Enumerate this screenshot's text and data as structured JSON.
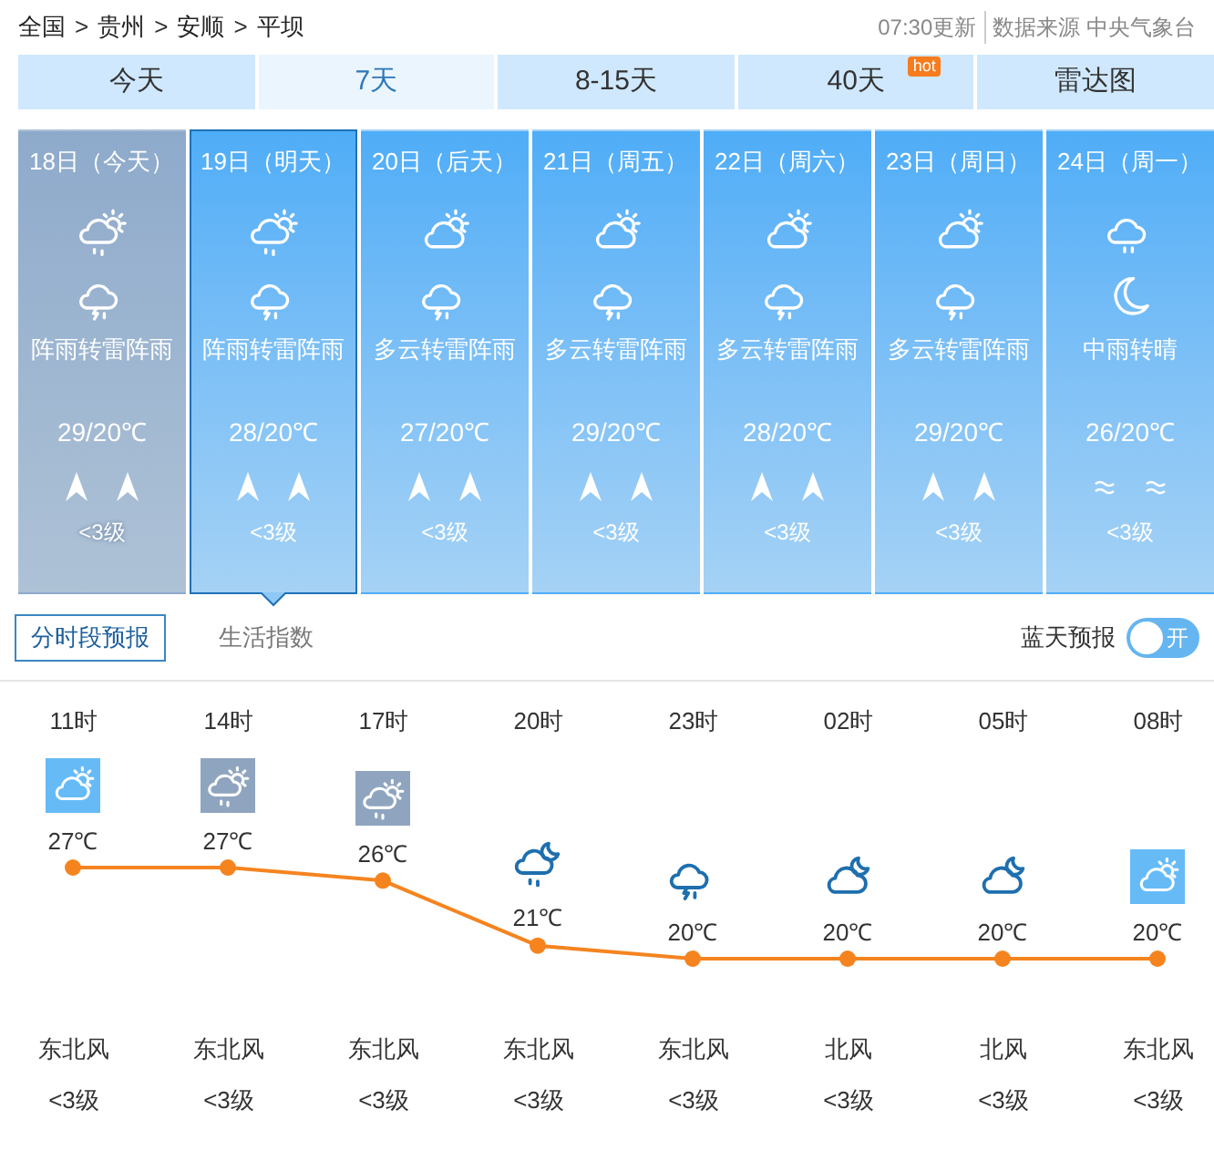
{
  "breadcrumb": [
    {
      "kind": "link",
      "text": "全国"
    },
    {
      "kind": "separator",
      "text": ">"
    },
    {
      "kind": "link",
      "text": "贵州"
    },
    {
      "kind": "separator",
      "text": ">"
    },
    {
      "kind": "link",
      "text": "安顺"
    },
    {
      "kind": "separator",
      "text": ">"
    },
    {
      "kind": "current",
      "text": "平坝"
    }
  ],
  "update_time": "07:30更新",
  "source": "数据来源 中央气象台",
  "tabs": [
    {
      "label": "今天",
      "selected": false
    },
    {
      "label": "7天",
      "selected": true
    },
    {
      "label": "8-15天",
      "selected": false
    },
    {
      "label": "40天",
      "selected": false,
      "badge": "hot"
    },
    {
      "label": "雷达图",
      "selected": false
    }
  ],
  "days": [
    {
      "date": "18日（今天）",
      "past": true,
      "selected": false,
      "icons": [
        {
          "kind": "shower"
        },
        {
          "kind": "thunder"
        }
      ],
      "weather": "阵雨转雷阵雨",
      "temp": "29/20℃",
      "wind_icons": [
        {
          "kind": "arrow"
        },
        {
          "kind": "arrow"
        }
      ],
      "wind_level": "<3级"
    },
    {
      "date": "19日（明天）",
      "past": false,
      "selected": true,
      "icons": [
        {
          "kind": "shower"
        },
        {
          "kind": "thunder"
        }
      ],
      "weather": "阵雨转雷阵雨",
      "temp": "28/20℃",
      "wind_icons": [
        {
          "kind": "arrow"
        },
        {
          "kind": "arrow"
        }
      ],
      "wind_level": "<3级"
    },
    {
      "date": "20日（后天）",
      "past": false,
      "selected": false,
      "icons": [
        {
          "kind": "cloudy"
        },
        {
          "kind": "thunder"
        }
      ],
      "weather": "多云转雷阵雨",
      "temp": "27/20℃",
      "wind_icons": [
        {
          "kind": "arrow"
        },
        {
          "kind": "arrow"
        }
      ],
      "wind_level": "<3级"
    },
    {
      "date": "21日（周五）",
      "past": false,
      "selected": false,
      "icons": [
        {
          "kind": "cloudy"
        },
        {
          "kind": "thunder"
        }
      ],
      "weather": "多云转雷阵雨",
      "temp": "29/20℃",
      "wind_icons": [
        {
          "kind": "arrow"
        },
        {
          "kind": "arrow"
        }
      ],
      "wind_level": "<3级"
    },
    {
      "date": "22日（周六）",
      "past": false,
      "selected": false,
      "icons": [
        {
          "kind": "cloudy"
        },
        {
          "kind": "thunder"
        }
      ],
      "weather": "多云转雷阵雨",
      "temp": "28/20℃",
      "wind_icons": [
        {
          "kind": "arrow"
        },
        {
          "kind": "arrow"
        }
      ],
      "wind_level": "<3级"
    },
    {
      "date": "23日（周日）",
      "past": false,
      "selected": false,
      "icons": [
        {
          "kind": "cloudy"
        },
        {
          "kind": "thunder"
        }
      ],
      "weather": "多云转雷阵雨",
      "temp": "29/20℃",
      "wind_icons": [
        {
          "kind": "arrow"
        },
        {
          "kind": "arrow"
        }
      ],
      "wind_level": "<3级"
    },
    {
      "date": "24日（周一）",
      "past": false,
      "selected": false,
      "icons": [
        {
          "kind": "rain"
        },
        {
          "kind": "moon"
        }
      ],
      "weather": "中雨转晴",
      "temp": "26/20℃",
      "wind_icons": [
        {
          "kind": "wave"
        },
        {
          "kind": "wave"
        }
      ],
      "wind_level": "<3级"
    }
  ],
  "subtabs": [
    {
      "label": "分时段预报",
      "selected": true
    },
    {
      "label": "生活指数",
      "selected": false
    }
  ],
  "blue_sky_toggle": {
    "label": "蓝天预报",
    "on": true,
    "text": "开"
  },
  "hours": [
    {
      "time": "11时",
      "icon": {
        "kind": "cloudy",
        "tile": true,
        "color": "#66bbf7"
      },
      "temp": "27℃",
      "wind_dir": "东北风",
      "wind_level": "<3级"
    },
    {
      "time": "14时",
      "icon": {
        "kind": "shower",
        "tile": true,
        "color": "#8fa5bf"
      },
      "temp": "27℃",
      "wind_dir": "东北风",
      "wind_level": "<3级"
    },
    {
      "time": "17时",
      "icon": {
        "kind": "shower",
        "tile": true,
        "color": "#8fa5bf"
      },
      "temp": "26℃",
      "wind_dir": "东北风",
      "wind_level": "<3级"
    },
    {
      "time": "20时",
      "icon": {
        "kind": "nightshower",
        "tile": false
      },
      "temp": "21℃",
      "wind_dir": "东北风",
      "wind_level": "<3级"
    },
    {
      "time": "23时",
      "icon": {
        "kind": "thunder",
        "tile": false
      },
      "temp": "20℃",
      "wind_dir": "东北风",
      "wind_level": "<3级"
    },
    {
      "time": "02时",
      "icon": {
        "kind": "nightcloudy",
        "tile": false
      },
      "temp": "20℃",
      "wind_dir": "北风",
      "wind_level": "<3级"
    },
    {
      "time": "05时",
      "icon": {
        "kind": "nightcloudy",
        "tile": false
      },
      "temp": "20℃",
      "wind_dir": "北风",
      "wind_level": "<3级"
    },
    {
      "time": "08时",
      "icon": {
        "kind": "cloudy",
        "tile": true,
        "color": "#66bbf7"
      },
      "temp": "20℃",
      "wind_dir": "东北风",
      "wind_level": "<3级"
    }
  ]
}
